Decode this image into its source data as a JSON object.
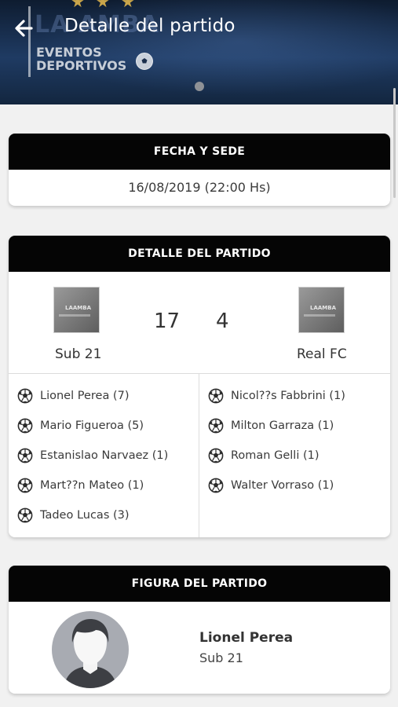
{
  "header": {
    "title": "Detalle del partido",
    "logo_bg": "LA AMBA",
    "logo_line1": "EVENTOS",
    "logo_line2": "DEPORTIVOS"
  },
  "date_card": {
    "heading": "FECHA Y SEDE",
    "date": "16/08/2019 (22:00 Hs)"
  },
  "match_card": {
    "heading": "DETALLE DEL PARTIDO",
    "home": {
      "name": "Sub 21",
      "score": "17"
    },
    "away": {
      "name": "Real FC",
      "score": "4"
    },
    "home_scorers": [
      "Lionel Perea (7)",
      "Mario Figueroa (5)",
      "Estanislao Narvaez (1)",
      "Mart??n Mateo (1)",
      "Tadeo Lucas (3)"
    ],
    "away_scorers": [
      "Nicol??s Fabbrini (1)",
      "Milton Garraza (1)",
      "Roman Gelli (1)",
      "Walter Vorraso (1)"
    ]
  },
  "figure_card": {
    "heading": "FIGURA DEL PARTIDO",
    "player_name": "Lionel Perea",
    "player_team": "Sub 21"
  },
  "icons": [
    "back-arrow-icon",
    "soccer-ball-icon",
    "team-logo",
    "avatar"
  ]
}
